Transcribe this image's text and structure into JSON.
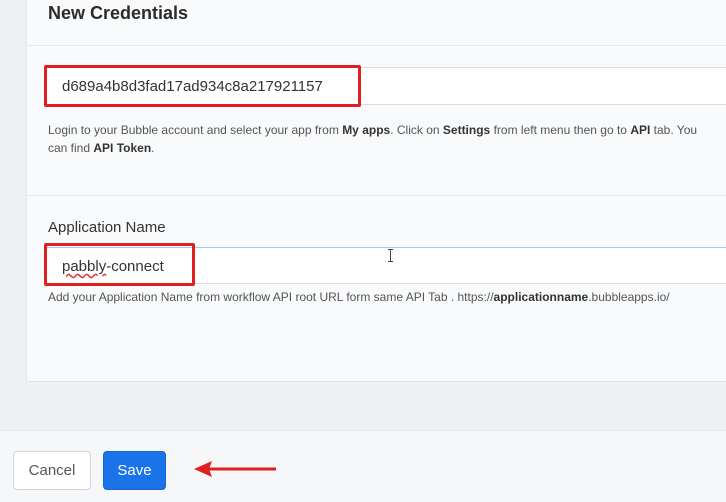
{
  "card": {
    "title": "New Credentials",
    "api_token": {
      "value": "d689a4b8d3fad17ad934c8a217921157",
      "help_parts": [
        "Login to your Bubble account and select your app from ",
        "My apps",
        ". Click on ",
        "Settings",
        " from left menu then go to ",
        "API",
        " tab. You",
        "can find ",
        "API Token",
        "."
      ]
    },
    "app_name": {
      "label": "Application Name",
      "value_word1": "pabbly",
      "value_rest": "-connect",
      "help_parts": [
        "Add your Application Name from workflow API root URL form same API Tab . https://",
        "applicationname",
        ".bubbleapps.io/"
      ]
    }
  },
  "footer": {
    "cancel_label": "Cancel",
    "save_label": "Save"
  },
  "colors": {
    "highlight": "#e02020",
    "primary": "#1a73e8"
  }
}
